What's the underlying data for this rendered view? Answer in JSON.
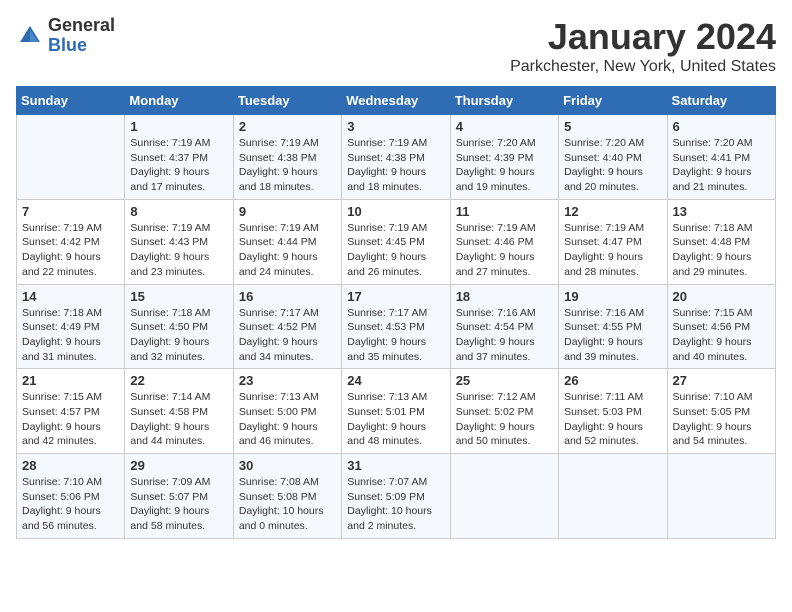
{
  "header": {
    "logo": {
      "general": "General",
      "blue": "Blue"
    },
    "title": "January 2024",
    "location": "Parkchester, New York, United States"
  },
  "days_of_week": [
    "Sunday",
    "Monday",
    "Tuesday",
    "Wednesday",
    "Thursday",
    "Friday",
    "Saturday"
  ],
  "weeks": [
    [
      {
        "day": "",
        "sunrise": "",
        "sunset": "",
        "daylight": ""
      },
      {
        "day": "1",
        "sunrise": "Sunrise: 7:19 AM",
        "sunset": "Sunset: 4:37 PM",
        "daylight": "Daylight: 9 hours and 17 minutes."
      },
      {
        "day": "2",
        "sunrise": "Sunrise: 7:19 AM",
        "sunset": "Sunset: 4:38 PM",
        "daylight": "Daylight: 9 hours and 18 minutes."
      },
      {
        "day": "3",
        "sunrise": "Sunrise: 7:19 AM",
        "sunset": "Sunset: 4:38 PM",
        "daylight": "Daylight: 9 hours and 18 minutes."
      },
      {
        "day": "4",
        "sunrise": "Sunrise: 7:20 AM",
        "sunset": "Sunset: 4:39 PM",
        "daylight": "Daylight: 9 hours and 19 minutes."
      },
      {
        "day": "5",
        "sunrise": "Sunrise: 7:20 AM",
        "sunset": "Sunset: 4:40 PM",
        "daylight": "Daylight: 9 hours and 20 minutes."
      },
      {
        "day": "6",
        "sunrise": "Sunrise: 7:20 AM",
        "sunset": "Sunset: 4:41 PM",
        "daylight": "Daylight: 9 hours and 21 minutes."
      }
    ],
    [
      {
        "day": "7",
        "sunrise": "Sunrise: 7:19 AM",
        "sunset": "Sunset: 4:42 PM",
        "daylight": "Daylight: 9 hours and 22 minutes."
      },
      {
        "day": "8",
        "sunrise": "Sunrise: 7:19 AM",
        "sunset": "Sunset: 4:43 PM",
        "daylight": "Daylight: 9 hours and 23 minutes."
      },
      {
        "day": "9",
        "sunrise": "Sunrise: 7:19 AM",
        "sunset": "Sunset: 4:44 PM",
        "daylight": "Daylight: 9 hours and 24 minutes."
      },
      {
        "day": "10",
        "sunrise": "Sunrise: 7:19 AM",
        "sunset": "Sunset: 4:45 PM",
        "daylight": "Daylight: 9 hours and 26 minutes."
      },
      {
        "day": "11",
        "sunrise": "Sunrise: 7:19 AM",
        "sunset": "Sunset: 4:46 PM",
        "daylight": "Daylight: 9 hours and 27 minutes."
      },
      {
        "day": "12",
        "sunrise": "Sunrise: 7:19 AM",
        "sunset": "Sunset: 4:47 PM",
        "daylight": "Daylight: 9 hours and 28 minutes."
      },
      {
        "day": "13",
        "sunrise": "Sunrise: 7:18 AM",
        "sunset": "Sunset: 4:48 PM",
        "daylight": "Daylight: 9 hours and 29 minutes."
      }
    ],
    [
      {
        "day": "14",
        "sunrise": "Sunrise: 7:18 AM",
        "sunset": "Sunset: 4:49 PM",
        "daylight": "Daylight: 9 hours and 31 minutes."
      },
      {
        "day": "15",
        "sunrise": "Sunrise: 7:18 AM",
        "sunset": "Sunset: 4:50 PM",
        "daylight": "Daylight: 9 hours and 32 minutes."
      },
      {
        "day": "16",
        "sunrise": "Sunrise: 7:17 AM",
        "sunset": "Sunset: 4:52 PM",
        "daylight": "Daylight: 9 hours and 34 minutes."
      },
      {
        "day": "17",
        "sunrise": "Sunrise: 7:17 AM",
        "sunset": "Sunset: 4:53 PM",
        "daylight": "Daylight: 9 hours and 35 minutes."
      },
      {
        "day": "18",
        "sunrise": "Sunrise: 7:16 AM",
        "sunset": "Sunset: 4:54 PM",
        "daylight": "Daylight: 9 hours and 37 minutes."
      },
      {
        "day": "19",
        "sunrise": "Sunrise: 7:16 AM",
        "sunset": "Sunset: 4:55 PM",
        "daylight": "Daylight: 9 hours and 39 minutes."
      },
      {
        "day": "20",
        "sunrise": "Sunrise: 7:15 AM",
        "sunset": "Sunset: 4:56 PM",
        "daylight": "Daylight: 9 hours and 40 minutes."
      }
    ],
    [
      {
        "day": "21",
        "sunrise": "Sunrise: 7:15 AM",
        "sunset": "Sunset: 4:57 PM",
        "daylight": "Daylight: 9 hours and 42 minutes."
      },
      {
        "day": "22",
        "sunrise": "Sunrise: 7:14 AM",
        "sunset": "Sunset: 4:58 PM",
        "daylight": "Daylight: 9 hours and 44 minutes."
      },
      {
        "day": "23",
        "sunrise": "Sunrise: 7:13 AM",
        "sunset": "Sunset: 5:00 PM",
        "daylight": "Daylight: 9 hours and 46 minutes."
      },
      {
        "day": "24",
        "sunrise": "Sunrise: 7:13 AM",
        "sunset": "Sunset: 5:01 PM",
        "daylight": "Daylight: 9 hours and 48 minutes."
      },
      {
        "day": "25",
        "sunrise": "Sunrise: 7:12 AM",
        "sunset": "Sunset: 5:02 PM",
        "daylight": "Daylight: 9 hours and 50 minutes."
      },
      {
        "day": "26",
        "sunrise": "Sunrise: 7:11 AM",
        "sunset": "Sunset: 5:03 PM",
        "daylight": "Daylight: 9 hours and 52 minutes."
      },
      {
        "day": "27",
        "sunrise": "Sunrise: 7:10 AM",
        "sunset": "Sunset: 5:05 PM",
        "daylight": "Daylight: 9 hours and 54 minutes."
      }
    ],
    [
      {
        "day": "28",
        "sunrise": "Sunrise: 7:10 AM",
        "sunset": "Sunset: 5:06 PM",
        "daylight": "Daylight: 9 hours and 56 minutes."
      },
      {
        "day": "29",
        "sunrise": "Sunrise: 7:09 AM",
        "sunset": "Sunset: 5:07 PM",
        "daylight": "Daylight: 9 hours and 58 minutes."
      },
      {
        "day": "30",
        "sunrise": "Sunrise: 7:08 AM",
        "sunset": "Sunset: 5:08 PM",
        "daylight": "Daylight: 10 hours and 0 minutes."
      },
      {
        "day": "31",
        "sunrise": "Sunrise: 7:07 AM",
        "sunset": "Sunset: 5:09 PM",
        "daylight": "Daylight: 10 hours and 2 minutes."
      },
      {
        "day": "",
        "sunrise": "",
        "sunset": "",
        "daylight": ""
      },
      {
        "day": "",
        "sunrise": "",
        "sunset": "",
        "daylight": ""
      },
      {
        "day": "",
        "sunrise": "",
        "sunset": "",
        "daylight": ""
      }
    ]
  ]
}
